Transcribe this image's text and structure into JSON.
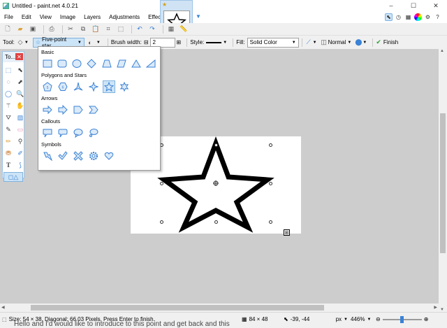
{
  "window": {
    "title": "Untitled - paint.net 4.0.21"
  },
  "menu": [
    "File",
    "Edit",
    "View",
    "Image",
    "Layers",
    "Adjustments",
    "Effects"
  ],
  "toolbar": {
    "tool_label": "Tool:",
    "shape_selected": "Five-point star",
    "brush_width_label": "Brush width:",
    "brush_width_value": "2",
    "style_label": "Style:",
    "fill_label": "Fill:",
    "fill_value": "Solid Color",
    "blend_mode": "Normal",
    "finish_label": "Finish"
  },
  "tools_window": {
    "title": "To..."
  },
  "shape_panel": {
    "categories": [
      {
        "name": "Basic",
        "shapes": [
          "rectangle",
          "rounded-rectangle",
          "ellipse",
          "diamond",
          "trapezoid",
          "parallelogram",
          "triangle",
          "right-triangle"
        ]
      },
      {
        "name": "Polygons and Stars",
        "shapes": [
          "pentagon",
          "hexagon",
          "three-point-star",
          "four-point-star",
          "five-point-star",
          "six-point-star"
        ]
      },
      {
        "name": "Arrows",
        "shapes": [
          "arrow",
          "chevron-arrow",
          "pentagon-arrow",
          "chevron"
        ]
      },
      {
        "name": "Callouts",
        "shapes": [
          "rect-callout",
          "rounded-callout",
          "ellipse-callout",
          "cloud-callout"
        ]
      },
      {
        "name": "Symbols",
        "shapes": [
          "lightning",
          "checkmark",
          "x-mark",
          "gear",
          "heart"
        ]
      }
    ]
  },
  "status": {
    "message": "Size: 54 × 38, Diagonal: 66.03 Pixels. Press Enter to finish.",
    "image_size": "84 × 48",
    "cursor_pos": "-39, -44",
    "unit": "px",
    "zoom": "446%"
  },
  "bottom_partial_text": "Hello and I'd would like to introduce to this point and get back and this"
}
